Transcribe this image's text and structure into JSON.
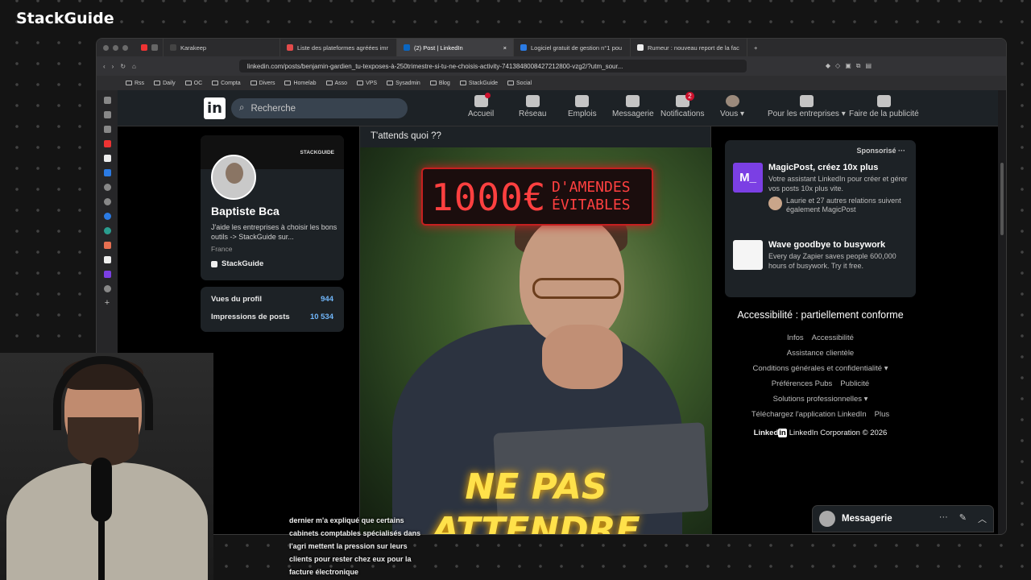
{
  "overlay": {
    "brand": "StackGuide",
    "subtitle": "dernier m'a expliqué que certains cabinets comptables spécialisés dans l'agri mettent la pression sur leurs clients pour rester chez eux pour la facture électronique"
  },
  "browser": {
    "tabs": [
      {
        "label": "Karakeep",
        "color": "#444"
      },
      {
        "label": "Liste des plateformes agréées imr",
        "color": "#e34b4b"
      },
      {
        "label": "(2) Post | LinkedIn",
        "color": "#0a66c2"
      },
      {
        "label": "Logiciel gratuit de gestion n°1 pou",
        "color": "#2b7be4"
      },
      {
        "label": "Rumeur : nouveau report de la fac",
        "color": "#eee"
      }
    ],
    "active_tab_close": "×",
    "new_tab": "+",
    "url": "linkedin.com/posts/benjamin-gardien_tu-texposes-à-250trimestre-si-tu-ne-choisis-activity-7413848008427212800-vzg2/?utm_sour...",
    "bookmarks": [
      "Rss",
      "Daily",
      "OC",
      "Compta",
      "Divers",
      "Homelab",
      "Asso",
      "VPS",
      "Sysadmin",
      "Blog",
      "StackGuide",
      "Social"
    ]
  },
  "linkedin": {
    "logo": "in",
    "search_placeholder": "Recherche",
    "nav": [
      {
        "label": "Accueil",
        "badge": ""
      },
      {
        "label": "Réseau",
        "badge": ""
      },
      {
        "label": "Emplois",
        "badge": ""
      },
      {
        "label": "Messagerie",
        "badge": ""
      },
      {
        "label": "Notifications",
        "badge": "2"
      },
      {
        "label": "Vous ▾",
        "badge": ""
      },
      {
        "label": "Pour les entreprises ▾",
        "badge": ""
      },
      {
        "label": "Faire de la publicité",
        "badge": ""
      }
    ],
    "profile": {
      "banner_tag": "STACKGUIDE",
      "name": "Baptiste Bca",
      "headline": "J'aide les entreprises à choisir les bons outils -> StackGuide sur...",
      "location": "France",
      "company": "StackGuide",
      "stats": [
        {
          "label": "Vues du profil",
          "value": "944"
        },
        {
          "label": "Impressions de posts",
          "value": "10 534"
        }
      ]
    },
    "post": {
      "text": "T'attends quoi ??",
      "sign_big": "1000€",
      "sign_small": "D'AMENDES ÉVITABLES",
      "caption_line1": "NE PAS",
      "caption_line2": "ATTENDRE"
    },
    "ads": {
      "header": "Sponsorisé ···",
      "items": [
        {
          "logo_text": "M_",
          "title": "MagicPost, créez 10x plus",
          "desc": "Votre assistant LinkedIn pour créer et gérer vos posts 10x plus vite.",
          "relation": "Laurie et 27 autres relations suivent également MagicPost",
          "relation_name": "Laurie",
          "color": "#7b3fe4"
        },
        {
          "logo_text": "",
          "title": "Wave goodbye to busywork",
          "desc": "Every day Zapier saves people 600,000 hours of busywork. Try it free.",
          "relation": "",
          "color": "#f5f5f5"
        }
      ]
    },
    "accessibility": "Accessibilité : partiellement conforme",
    "footer_rows": [
      [
        "Infos",
        "Accessibilité"
      ],
      [
        "Assistance clientèle"
      ],
      [
        "Conditions générales et confidentialité ▾"
      ],
      [
        "Préférences Pubs",
        "Publicité"
      ],
      [
        "Solutions professionnelles ▾"
      ],
      [
        "Téléchargez l'application LinkedIn",
        "Plus"
      ]
    ],
    "copyright_logo": "Linked",
    "copyright_logo_in": "in",
    "copyright": "LinkedIn Corporation © 2026",
    "messaging": {
      "label": "Messagerie",
      "more": "···",
      "compose": "✎",
      "collapse": "︿"
    }
  }
}
